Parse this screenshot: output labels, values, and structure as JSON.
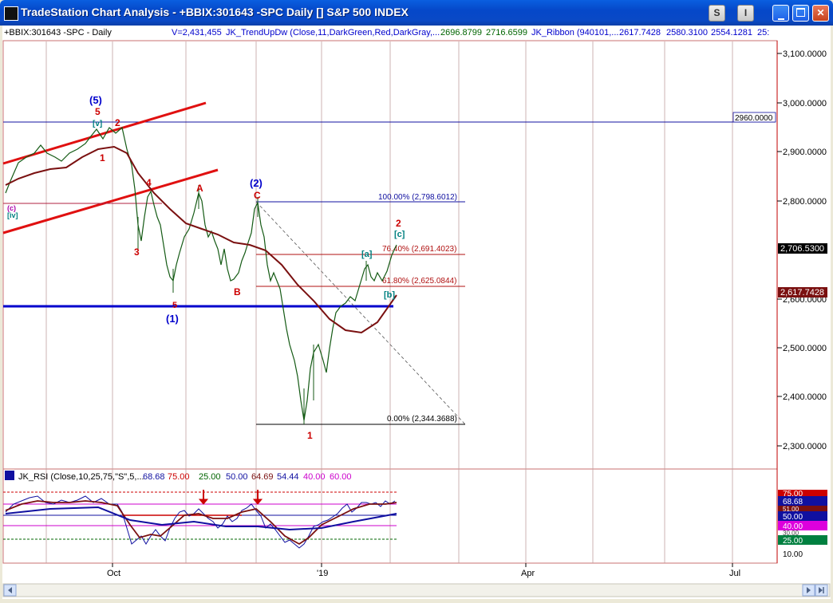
{
  "window": {
    "title": "TradeStation Chart Analysis - +BBIX:301643 -SPC Daily [] S&P 500 INDEX",
    "buttons": {
      "s": "S",
      "i": "I"
    }
  },
  "header": {
    "symbol": "+BBIX:301643 -SPC - Daily",
    "volume": "V=2,431,455",
    "trend_study": "JK_TrendUpDw (Close,11,DarkGreen,Red,DarkGray,...",
    "trend_v1": "2696.8799",
    "trend_v2": "2716.6599",
    "ribbon_study": "JK_Ribbon (940101,...",
    "ribbon_v1": "2617.7428",
    "ribbon_v2": "2580.3100",
    "ribbon_v3": "2554.1281",
    "ribbon_v4": "25:"
  },
  "price_axis": {
    "ticks": [
      "3,100.0000",
      "3,000.0000",
      "2,900.0000",
      "2,800.0000",
      "2,600.0000",
      "2,500.0000",
      "2,400.0000",
      "2,300.0000"
    ],
    "last_price": "2,706.5300",
    "ribbon_price": "2,617.7428",
    "h_level_label": "2960.0000"
  },
  "fib_labels": {
    "f100": "100.00% (2,798.6012)",
    "f764": "76.40% (2,691.4023)",
    "f618": "61.80% (2,625.0844)",
    "f0": "0.00% (2,344.3688)"
  },
  "wave_labels": {
    "p5": "(5)",
    "r5": "5",
    "v": "[v]",
    "r2a": "2",
    "r1a": "1",
    "c_lower": "(c)",
    "iv": "[iv]",
    "r4": "4",
    "r3": "3",
    "r5b": "5",
    "p1": "(1)",
    "A": "A",
    "B": "B",
    "p2": "(2)",
    "C": "C",
    "r1b": "1",
    "a": "[a]",
    "b": "[b]",
    "c_sq": "[c]",
    "r2b": "2"
  },
  "rsi": {
    "study": "JK_RSI (Close,10,25,75,\"S\",5,...",
    "v1": "68.68",
    "v2": "75.00",
    "v3": "25.00",
    "v4": "50.00",
    "v5": "64.69",
    "v6": "54.44",
    "v7": "40.00",
    "v8": "60.00",
    "axis": [
      "75.00",
      "68.68",
      "51.00",
      "50.00",
      "40.00",
      "30.00",
      "25.00",
      "10.00"
    ]
  },
  "time_axis": [
    "Oct",
    "'19",
    "Apr",
    "Jul"
  ],
  "colors": {
    "red": "#CC0000",
    "blue": "#0000CC",
    "teal": "#008080",
    "darkred": "#7A1010",
    "green": "#006400"
  }
}
